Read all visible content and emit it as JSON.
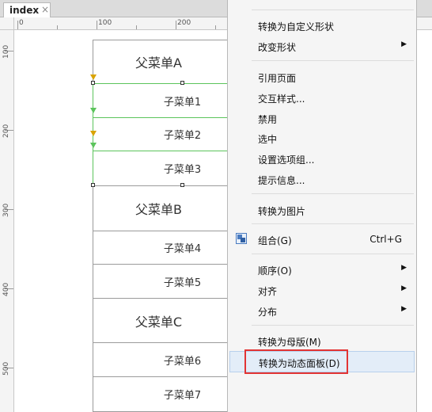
{
  "tab": {
    "label": "index",
    "close": "×"
  },
  "ruler_top": [
    "0",
    "100",
    "200"
  ],
  "ruler_left": [
    "100",
    "200",
    "300",
    "400",
    "500"
  ],
  "canvas": {
    "parent_a": "父菜单A",
    "child_1": "子菜单1",
    "child_2": "子菜单2",
    "child_3": "子菜单3",
    "parent_b": "父菜单B",
    "child_4": "子菜单4",
    "child_5": "子菜单5",
    "parent_c": "父菜单C",
    "child_6": "子菜单6",
    "child_7": "子菜单7"
  },
  "context_menu": {
    "convert_custom_shape": "转换为自定义形状",
    "change_shape": "改变形状",
    "reference_page": "引用页面",
    "interaction_style": "交互样式...",
    "disable": "禁用",
    "select": "选中",
    "set_option_group": "设置选项组...",
    "tooltip_info": "提示信息...",
    "convert_image": "转换为图片",
    "group": "组合(G)",
    "group_shortcut": "Ctrl+G",
    "order": "顺序(O)",
    "align": "对齐",
    "distribute": "分布",
    "convert_master": "转换为母版(M)",
    "convert_dynamic_panel": "转换为动态面板(D)",
    "submenu_arrow": "▶"
  }
}
